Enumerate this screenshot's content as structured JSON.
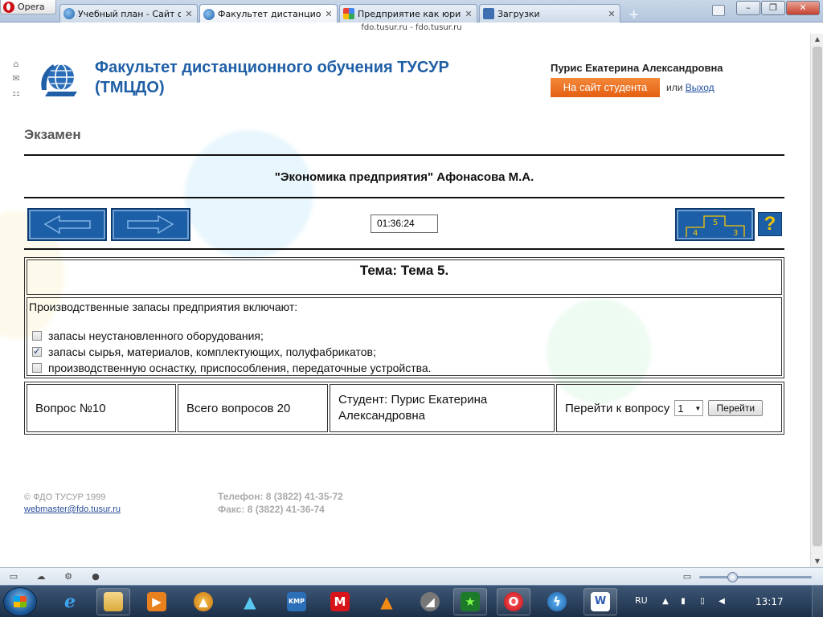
{
  "browser": {
    "menu_label": "Opera",
    "tabs": [
      {
        "title": "Учебный план - Сайт с...",
        "icon": "globe-icon"
      },
      {
        "title": "Факультет дистанционно...",
        "icon": "globe-icon"
      },
      {
        "title": "Предприятие как юри...",
        "icon": "google-icon"
      },
      {
        "title": "Загрузки",
        "icon": "downloads-icon"
      }
    ],
    "active_tab": 1,
    "address": "fdo.tusur.ru - fdo.tusur.ru",
    "window_buttons": [
      "minimize",
      "maximize",
      "close"
    ]
  },
  "header": {
    "site_title": "Факультет дистанционного обучения ТУСУР (ТМЦДО)",
    "user_name": "Пурис Екатерина Александровна",
    "student_site_button": "На сайт студента",
    "or_text": "или",
    "logout_link": "Выход"
  },
  "exam": {
    "heading": "Экзамен",
    "course": "\"Экономика предприятия\" Афонасова М.А.",
    "timer": "01:36:24",
    "podium_labels": [
      "4",
      "5",
      "3"
    ],
    "help_label": "?",
    "theme": "Тема: Тема 5.",
    "question": "Производственные запасы предприятия включают:",
    "options": [
      {
        "text": "запасы неустановленного оборудования;",
        "checked": false
      },
      {
        "text": "запасы сырья, материалов, комплектующих, полуфабрикатов;",
        "checked": true
      },
      {
        "text": "производственную оснастку, приспособления, передаточные устройства.",
        "checked": false
      }
    ],
    "question_number": "Вопрос №10",
    "total_questions": "Всего вопросов 20",
    "student": "Студент: Пурис Екатерина Александровна",
    "goto_label": "Перейти к вопросу",
    "goto_value": "1",
    "goto_button": "Перейти"
  },
  "footer": {
    "copyright": "© ФДО ТУСУР 1999",
    "email": "webmaster@fdo.tusur.ru",
    "phone": "Телефон: 8 (3822) 41-35-72",
    "fax": "Факс: 8 (3822) 41-36-74"
  },
  "taskbar": {
    "language": "RU",
    "clock": "13:17",
    "apps": [
      "internet-explorer-icon",
      "file-explorer-icon",
      "media-player-icon",
      "aimp-icon",
      "app-triangle-icon",
      "kmplayer-icon",
      "mail-ru-icon",
      "vlc-icon",
      "satellite-icon",
      "game-star-icon",
      "opera-icon",
      "lightning-icon",
      "word-icon"
    ]
  },
  "colors": {
    "brand_blue": "#1f5fa6",
    "student_button": "#e8661c",
    "nav_button": "#1c5fa6"
  }
}
